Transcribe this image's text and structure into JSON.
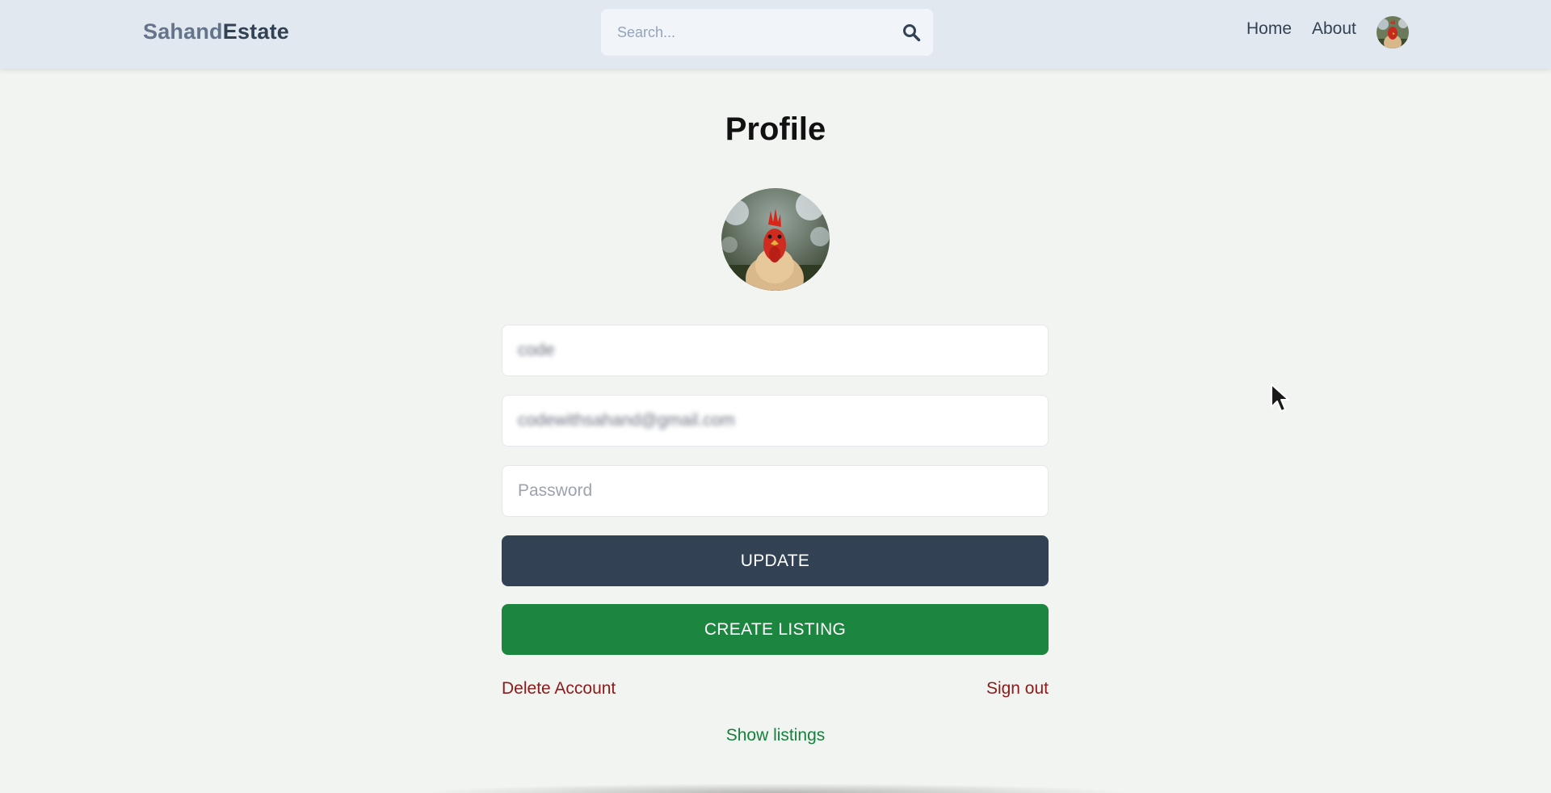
{
  "header": {
    "logo_part1": "Sahand",
    "logo_part2": "Estate",
    "search_placeholder": "Search...",
    "nav": [
      "Home",
      "About"
    ]
  },
  "profile": {
    "title": "Profile",
    "username_value": "code",
    "email_value": "codewithsahand@gmail.com",
    "password_placeholder": "Password",
    "update_label": "UPDATE",
    "create_listing_label": "CREATE LISTING",
    "delete_account_label": "Delete Account",
    "sign_out_label": "Sign out",
    "show_listings_label": "Show listings"
  },
  "colors": {
    "header_bg": "#e2e8f0",
    "page_bg": "#f2f4f1",
    "update_button": "#334155",
    "create_button": "#1c853f",
    "danger_text": "#8b1a1a",
    "success_text": "#15803d"
  },
  "icons": {
    "search": "magnifier-icon",
    "avatar": "rooster-photo"
  }
}
